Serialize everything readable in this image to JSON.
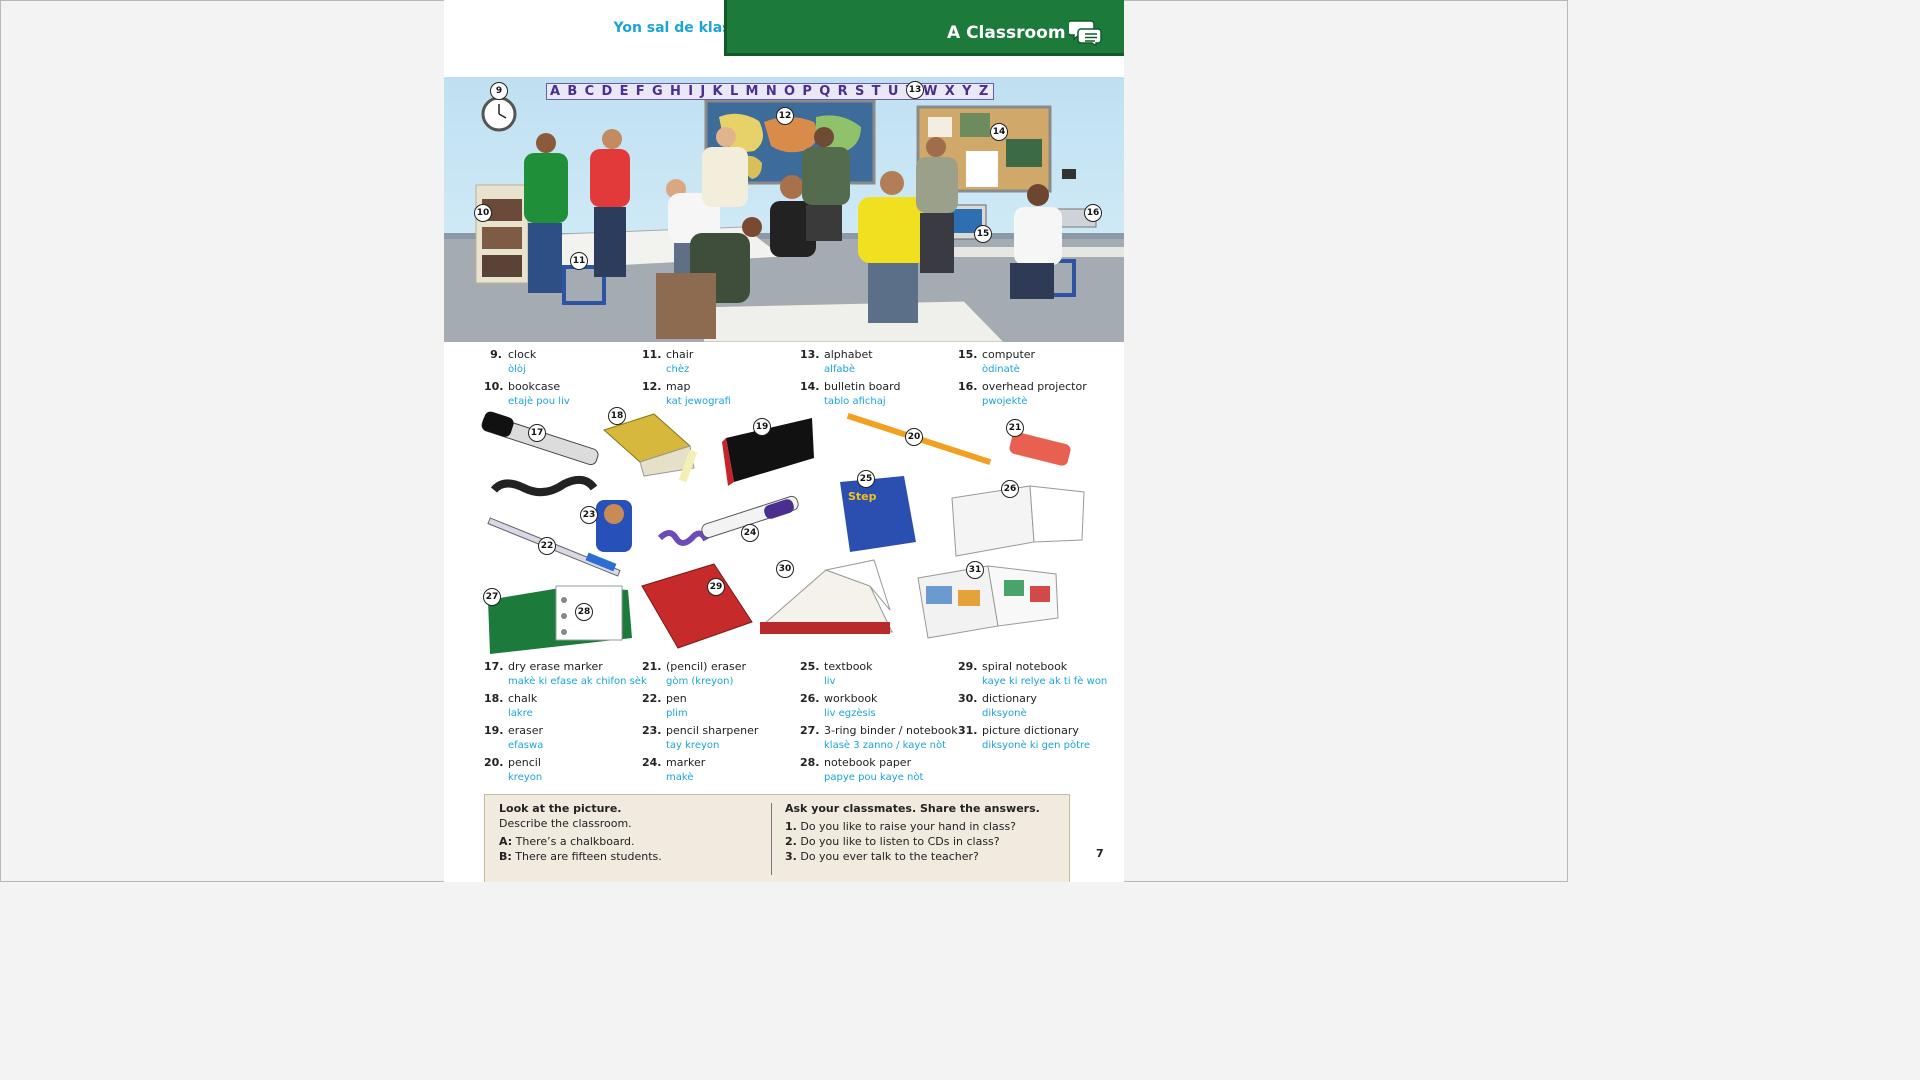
{
  "header": {
    "left_title": "Yon sal de klas",
    "right_title": "A Classroom"
  },
  "scene": {
    "alphabet": "A B C D E F G H I J K L M N O P Q R S T U V W X Y Z",
    "callouts": [
      "9",
      "10",
      "11",
      "12",
      "13",
      "14",
      "15",
      "16"
    ]
  },
  "vocab_top": [
    {
      "n": "9.",
      "en": "clock",
      "ht": "òlòj"
    },
    {
      "n": "10.",
      "en": "bookcase",
      "ht": "etajè pou liv"
    },
    {
      "n": "11.",
      "en": "chair",
      "ht": "chèz"
    },
    {
      "n": "12.",
      "en": "map",
      "ht": "kat jewografi"
    },
    {
      "n": "13.",
      "en": "alphabet",
      "ht": "alfabè"
    },
    {
      "n": "14.",
      "en": "bulletin board",
      "ht": "tablo afichaj"
    },
    {
      "n": "15.",
      "en": "computer",
      "ht": "òdinatè"
    },
    {
      "n": "16.",
      "en": "overhead projector",
      "ht": "pwojektè"
    }
  ],
  "supplies_numbers": [
    "17",
    "18",
    "19",
    "20",
    "21",
    "22",
    "23",
    "24",
    "25",
    "26",
    "27",
    "28",
    "29",
    "30",
    "31"
  ],
  "vocab_bottom": [
    {
      "n": "17.",
      "en": "dry erase marker",
      "ht": "makè ki efase ak chifon sèk"
    },
    {
      "n": "18.",
      "en": "chalk",
      "ht": "lakre"
    },
    {
      "n": "19.",
      "en": "eraser",
      "ht": "efaswa"
    },
    {
      "n": "20.",
      "en": "pencil",
      "ht": "kreyon"
    },
    {
      "n": "21.",
      "en": "(pencil) eraser",
      "ht": "gòm (kreyon)"
    },
    {
      "n": "22.",
      "en": "pen",
      "ht": "plim"
    },
    {
      "n": "23.",
      "en": "pencil sharpener",
      "ht": "tay kreyon"
    },
    {
      "n": "24.",
      "en": "marker",
      "ht": "makè"
    },
    {
      "n": "25.",
      "en": "textbook",
      "ht": "liv"
    },
    {
      "n": "26.",
      "en": "workbook",
      "ht": "liv egzèsis"
    },
    {
      "n": "27.",
      "en": "3-ring binder / notebook",
      "ht": "klasè 3 zanno / kaye nòt"
    },
    {
      "n": "28.",
      "en": "notebook paper",
      "ht": "papye pou kaye nòt"
    },
    {
      "n": "29.",
      "en": "spiral notebook",
      "ht": "kaye ki relye ak ti fè won"
    },
    {
      "n": "30.",
      "en": "dictionary",
      "ht": "diksyonè"
    },
    {
      "n": "31.",
      "en": "picture dictionary",
      "ht": "diksyonè ki gen pòtre"
    }
  ],
  "box": {
    "left_heading": "Look at the picture.",
    "left_sub": "Describe the classroom.",
    "a_label": "A:",
    "a_text": "There’s a chalkboard.",
    "b_label": "B:",
    "b_text": "There are fifteen students.",
    "right_heading": "Ask your classmates. Share the answers.",
    "questions": [
      {
        "n": "1.",
        "q": "Do you like to raise your hand in class?"
      },
      {
        "n": "2.",
        "q": "Do you like to listen to CDs in class?"
      },
      {
        "n": "3.",
        "q": "Do you ever talk to the teacher?"
      }
    ]
  },
  "page_number": "7",
  "textbook_cover": "Step",
  "colors": {
    "header_green": "#1c7a3a",
    "cyan_text": "#1ca4d8",
    "alphabet_purple": "#4b2f8f",
    "box_bg": "#f1ebdf"
  }
}
